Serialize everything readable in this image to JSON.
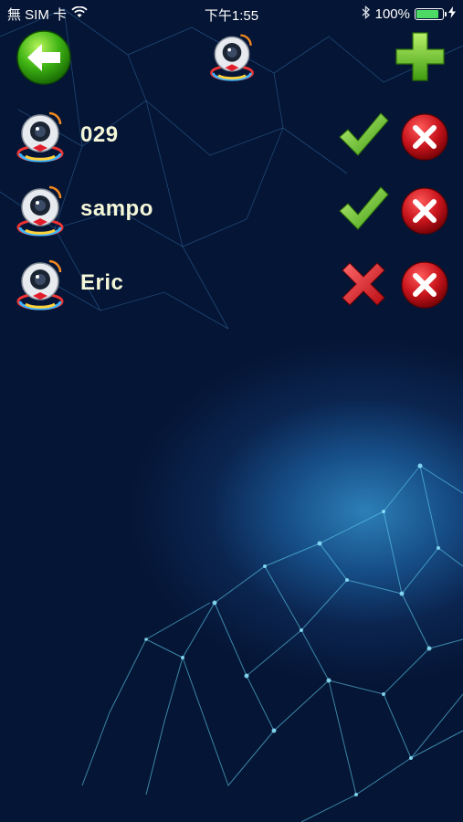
{
  "status_bar": {
    "carrier": "無 SIM 卡",
    "time": "下午1:55",
    "battery": "100%",
    "battery_level": 1.0
  },
  "header": {
    "back_icon": "back-arrow-icon",
    "logo_icon": "camera-logo-icon",
    "add_icon": "plus-icon"
  },
  "devices": [
    {
      "name": "029",
      "status": "online",
      "status_icon": "check-icon"
    },
    {
      "name": "sampo",
      "status": "online",
      "status_icon": "check-icon"
    },
    {
      "name": "Eric",
      "status": "offline",
      "status_icon": "cross-icon"
    }
  ],
  "colors": {
    "online": "#6fcf2a",
    "offline": "#e0141e",
    "delete": "#c8141c",
    "back": "#3fb414",
    "add": "#7ed321"
  }
}
